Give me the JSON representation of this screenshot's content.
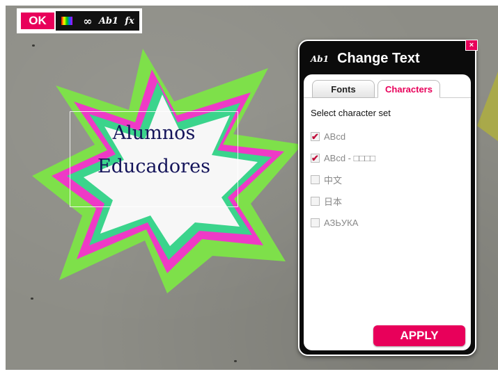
{
  "toolbar": {
    "ok_label": "OK",
    "buttons": [
      {
        "name": "palette-icon"
      },
      {
        "name": "link-icon",
        "glyph": "∞"
      },
      {
        "name": "text-style-button",
        "label": "Ab1"
      },
      {
        "name": "effects-button",
        "label": "fx"
      }
    ]
  },
  "star": {
    "line1": "Alumnos",
    "line2": "Educadores",
    "colors": {
      "outer": "#7ee04a",
      "pink": "#ee3ac6",
      "teal": "#3bd48c",
      "inner": "#f7f7f7"
    }
  },
  "dialog": {
    "title_icon": "Ab1",
    "title": "Change Text",
    "close": "×",
    "tabs": [
      {
        "label": "Fonts",
        "active": false
      },
      {
        "label": "Characters",
        "active": true
      }
    ],
    "section_label": "Select character set",
    "options": [
      {
        "label": "ABcd",
        "checked": true
      },
      {
        "label": "ABcd - □□□□",
        "checked": true
      },
      {
        "label": "中文",
        "checked": false
      },
      {
        "label": "日本",
        "checked": false
      },
      {
        "label": "АЗЬУКА",
        "checked": false
      }
    ],
    "apply_label": "APPLY"
  },
  "colors": {
    "accent": "#e8005a",
    "background": "#8d8d86"
  }
}
